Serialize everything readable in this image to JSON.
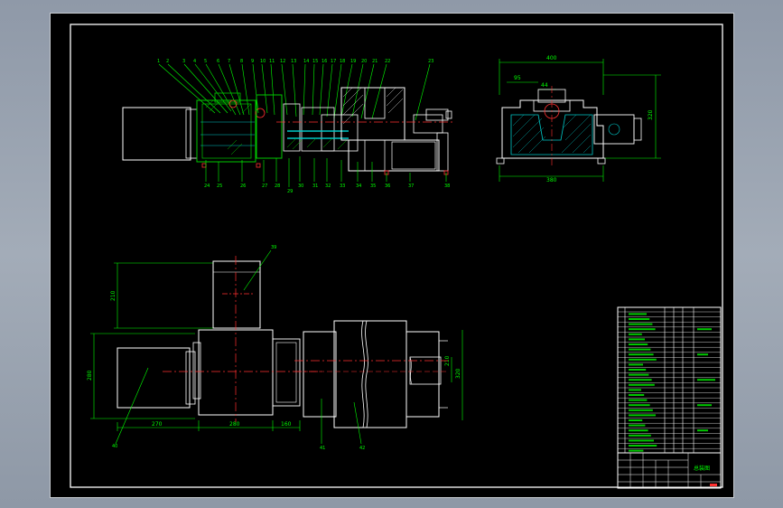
{
  "drawing": {
    "dims": {
      "top_width": "400",
      "top_left": "95",
      "top_mid": "44",
      "side_height": "320",
      "base_width": "380",
      "motor_height": "210",
      "reducer_height": "280",
      "len_a": "270",
      "len_b": "280",
      "len_c": "160",
      "right_h1": "210",
      "right_h2": "320"
    },
    "title_block": {
      "name": "总装图"
    }
  },
  "colors": {
    "background": "#000000",
    "frame": "#ffffff",
    "part_outline": "#ffffff",
    "section_green": "#00c800",
    "center_red": "#ff3030",
    "hatch_cyan": "#00c8c8",
    "dim_green": "#00ff00",
    "leader_yellow": "#ffff00",
    "magenta": "#ff40ff"
  }
}
